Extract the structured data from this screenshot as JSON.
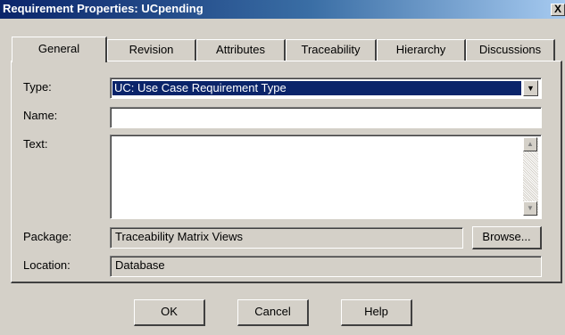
{
  "window": {
    "title": "Requirement Properties: UCpending",
    "close_label": "X"
  },
  "tabs": [
    {
      "label": "General",
      "active": true
    },
    {
      "label": "Revision",
      "active": false
    },
    {
      "label": "Attributes",
      "active": false
    },
    {
      "label": "Traceability",
      "active": false
    },
    {
      "label": "Hierarchy",
      "active": false
    },
    {
      "label": "Discussions",
      "active": false
    }
  ],
  "form": {
    "type_label": "Type:",
    "type_value": "UC: Use Case Requirement Type",
    "name_label": "Name:",
    "name_value": "",
    "text_label": "Text:",
    "text_value": "",
    "package_label": "Package:",
    "package_value": "Traceability Matrix Views",
    "browse_label": "Browse...",
    "location_label": "Location:",
    "location_value": "Database"
  },
  "buttons": {
    "ok": "OK",
    "cancel": "Cancel",
    "help": "Help"
  },
  "icons": {
    "close": "close-icon",
    "dropdown": "chevron-down-icon",
    "scroll_up": "arrow-up-icon",
    "scroll_down": "arrow-down-icon"
  }
}
